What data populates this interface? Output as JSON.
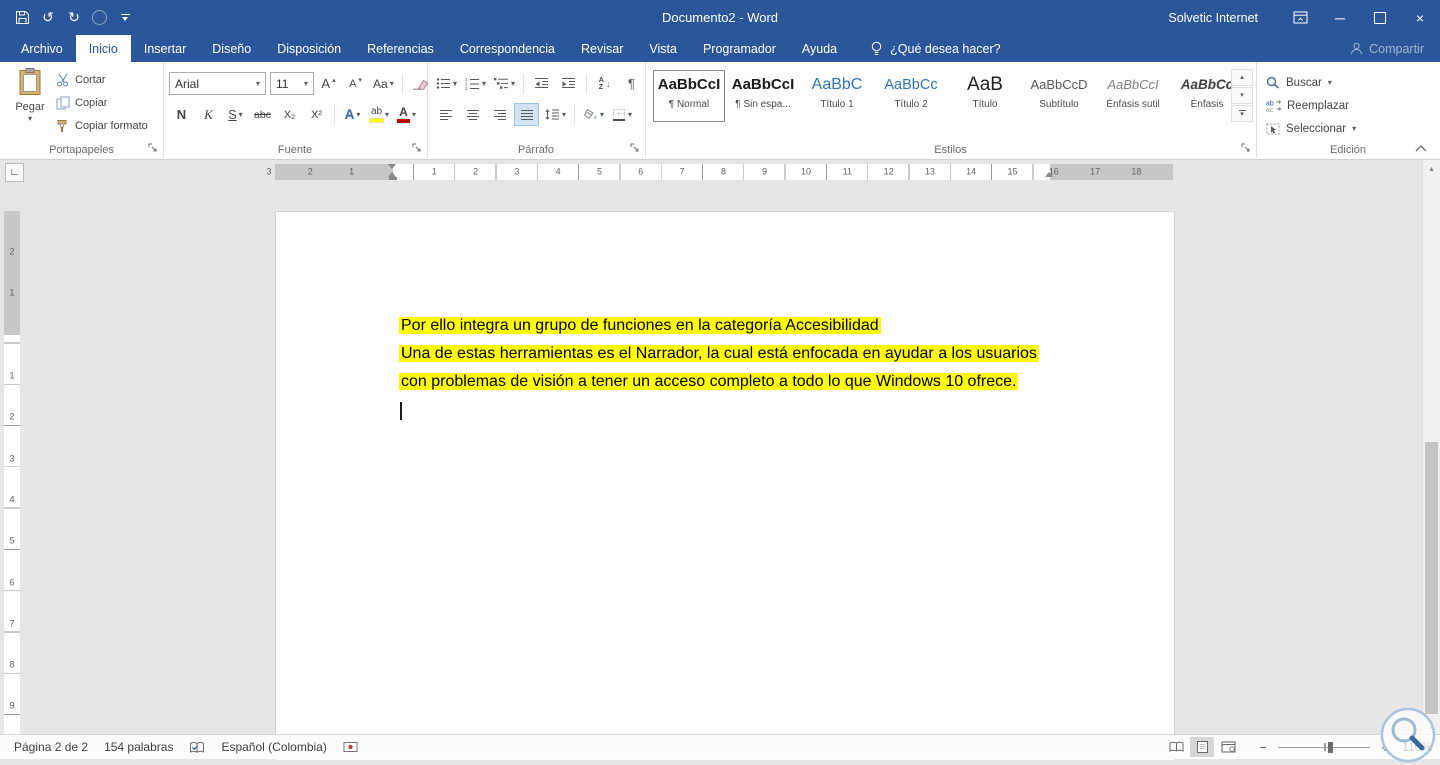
{
  "titlebar": {
    "title": "Documento2 - Word",
    "account": "Solvetic Internet"
  },
  "tabs": [
    {
      "label": "Archivo"
    },
    {
      "label": "Inicio"
    },
    {
      "label": "Insertar"
    },
    {
      "label": "Diseño"
    },
    {
      "label": "Disposición"
    },
    {
      "label": "Referencias"
    },
    {
      "label": "Correspondencia"
    },
    {
      "label": "Revisar"
    },
    {
      "label": "Vista"
    },
    {
      "label": "Programador"
    },
    {
      "label": "Ayuda"
    }
  ],
  "tellme": {
    "placeholder": "¿Qué desea hacer?"
  },
  "share": {
    "label": "Compartir"
  },
  "ribbon": {
    "clipboard": {
      "group_label": "Portapapeles",
      "paste_label": "Pegar",
      "cut_label": "Cortar",
      "copy_label": "Copiar",
      "format_painter_label": "Copiar formato"
    },
    "font": {
      "group_label": "Fuente",
      "font_name": "Arial",
      "font_size": "11",
      "bold": "N",
      "italic": "K",
      "underline": "S",
      "strikethrough": "abc",
      "subscript": "X₂",
      "superscript": "X²",
      "text_effects": "A",
      "highlight": "ab",
      "font_color": "A",
      "grow_font": "A",
      "shrink_font": "A",
      "change_case": "Aa"
    },
    "paragraph": {
      "group_label": "Párrafo",
      "sort_a": "A",
      "sort_z": "Z",
      "pilcrow": "¶"
    },
    "styles": {
      "group_label": "Estilos",
      "items": [
        {
          "preview": "AaBbCcI",
          "name": "¶ Normal"
        },
        {
          "preview": "AaBbCcI",
          "name": "¶ Sin espa..."
        },
        {
          "preview": "AaBbC",
          "name": "Título 1"
        },
        {
          "preview": "AaBbCc",
          "name": "Título 2"
        },
        {
          "preview": "AaB",
          "name": "Título"
        },
        {
          "preview": "AaBbCcD",
          "name": "Subtítulo"
        },
        {
          "preview": "AaBbCcI",
          "name": "Énfasis sutil"
        },
        {
          "preview": "AaBbCc",
          "name": "Énfasis"
        }
      ]
    },
    "editing": {
      "group_label": "Edición",
      "find_label": "Buscar",
      "replace_label": "Reemplazar",
      "select_label": "Seleccionar"
    }
  },
  "document": {
    "highlighted_lines": [
      "Por ello integra un grupo de funciones en la categoría Accesibilidad",
      "Una de estas herramientas es el Narrador, la cual está enfocada en ayudar a los usuarios",
      "con problemas de visión a tener un acceso completo a todo lo que Windows 10 ofrece."
    ],
    "highlight_color": "#ffff00"
  },
  "ruler": {
    "tab_selector": "∟",
    "h_premargin_marks": [
      "3",
      "2",
      "1"
    ],
    "h_marks": [
      "1",
      "2",
      "3",
      "4",
      "5",
      "6",
      "7",
      "8",
      "9",
      "10",
      "11",
      "12",
      "13",
      "14",
      "15",
      "16",
      "17",
      "18"
    ],
    "v_premargin_marks": [
      "2",
      "1"
    ],
    "v_marks": [
      "1",
      "2",
      "3",
      "4",
      "5",
      "6",
      "7",
      "8",
      "9"
    ]
  },
  "statusbar": {
    "page_indicator": "Página 2 de 2",
    "word_count": "154 palabras",
    "language": "Español (Colombia)",
    "zoom_out": "−",
    "zoom_in": "+",
    "zoom_level": "110%"
  },
  "glyphs": {
    "dropdown": "▾",
    "up_small": "▴",
    "down_arrow": "↓",
    "undo": "↺",
    "redo": "↻",
    "minimize": "─",
    "close": "×"
  },
  "colors": {
    "titlebar_blue": "#2b579a",
    "heading_blue": "#2e74b5",
    "highlight_yellow": "#ffff00",
    "font_color_red": "#c00000"
  }
}
